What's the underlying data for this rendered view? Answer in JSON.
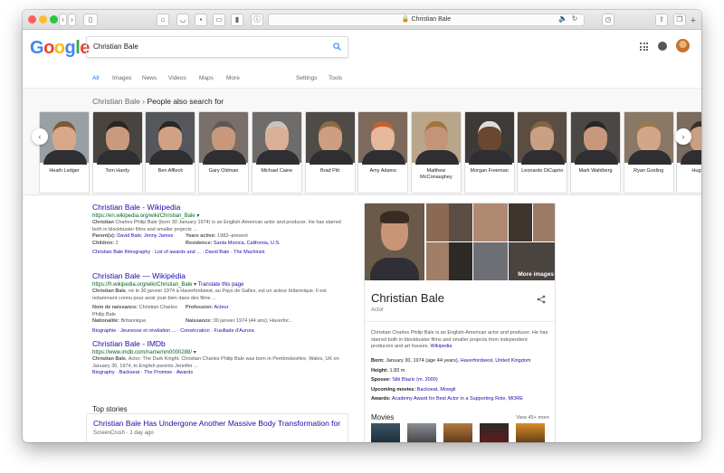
{
  "browser": {
    "address": "Christian Bale"
  },
  "search": {
    "query": "Christian Bale",
    "tabs": [
      "All",
      "Images",
      "News",
      "Videos",
      "Maps",
      "More"
    ],
    "tools": [
      "Settings",
      "Tools"
    ]
  },
  "logo": [
    "G",
    "o",
    "o",
    "g",
    "l",
    "e"
  ],
  "people_also": {
    "prefix": "Christian Bale",
    "sep": " › ",
    "title": "People also search for",
    "people": [
      {
        "name": "Heath Ledger"
      },
      {
        "name": "Tom Hardy"
      },
      {
        "name": "Ben Affleck"
      },
      {
        "name": "Gary Oldman"
      },
      {
        "name": "Michael Caine"
      },
      {
        "name": "Brad Pitt"
      },
      {
        "name": "Amy Adams"
      },
      {
        "name": "Matthew McConaughey"
      },
      {
        "name": "Morgan Freeman"
      },
      {
        "name": "Leonardo DiCaprio"
      },
      {
        "name": "Mark Wahlberg"
      },
      {
        "name": "Ryan Gosling"
      },
      {
        "name": "Hugh J..."
      }
    ]
  },
  "results": [
    {
      "title": "Christian Bale - Wikipedia",
      "url": "https://en.wikipedia.org/wiki/Christian_Bale",
      "snippet_bold": "Christian",
      "snippet": " Charles Philip Bale (born 30 January 1974) is an English-American actor and producer. He has starred both in blockbuster films and smaller projects ...",
      "facts": [
        {
          "k": "Parent(s):",
          "v": "David Bale; Jenny James"
        },
        {
          "k": "Years active:",
          "v": "1982–present"
        },
        {
          "k": "Children:",
          "v": "2"
        },
        {
          "k": "Residence:",
          "v": "Santa Monica, California, U.S."
        }
      ],
      "links": "Christian Bale filmography · List of awards and ... · David Bale · The Machinist"
    },
    {
      "title": "Christian Bale — Wikipédia",
      "url": "https://fr.wikipedia.org/wiki/Christian_Bale",
      "translate": "Translate this page",
      "snippet_bold": "Christian Bale",
      "snippet": ", né le 30 janvier 1974 à Haverfordwest, au Pays de Galles, est un acteur britannique. Il est notamment connu pour avoir joué bien dans des films ...",
      "facts": [
        {
          "k": "Nom de naissance:",
          "v": "Christian Charles Philip Bale"
        },
        {
          "k": "Profession:",
          "v": "Acteur"
        },
        {
          "k": "Nationalité:",
          "v": "Britannique"
        },
        {
          "k": "Naissance:",
          "v": "30 janvier 1974 (44 ans); Haverfor..."
        }
      ],
      "links": "Biographie · Jeunesse et révélation ... · Consécration · Fusillade d'Aurora"
    },
    {
      "title": "Christian Bale - IMDb",
      "url": "https://www.imdb.com/name/nm0000288/",
      "snippet_bold": "Christian Bale",
      "snippet": ", Actor: The Dark Knight. Christian Charles Philip Bale was born in Pembrokeshire, Wales, UK on January 30, 1974, to English parents Jennifer ...",
      "links": "Biography · Backseat · The Promise · Awards"
    }
  ],
  "top_stories": {
    "heading": "Top stories",
    "story_title": "Christian Bale Has Undergone Another Massive Body Transformation for",
    "story_meta": "ScreenCrush · 1 day ago"
  },
  "knowledge_panel": {
    "name": "Christian Bale",
    "subtitle": "Actor",
    "more_images": "More images",
    "description": "Christian Charles Philip Bale is an English-American actor and producer. He has starred both in blockbuster films and smaller projects from independent producers and art houses.",
    "source": "Wikipedia",
    "facts": [
      {
        "k": "Born:",
        "v": "January 30, 1974 (age 44 years), ",
        "link": "Haverfordwest, United Kingdom"
      },
      {
        "k": "Height:",
        "v": "1.83 m",
        "link": ""
      },
      {
        "k": "Spouse:",
        "v": "",
        "link": "Sibi Blazic (m. 2000)"
      },
      {
        "k": "Upcoming movies:",
        "v": "",
        "link": "Backseat, Mowgli"
      },
      {
        "k": "Awards:",
        "v": "",
        "link": "Academy Award for Best Actor in a Supporting Role, MORE"
      }
    ],
    "movies_heading": "Movies",
    "view_more": "View 45+ more"
  },
  "colors": {
    "link": "#1a0dab",
    "url": "#006621",
    "accent": "#1a73e8"
  }
}
